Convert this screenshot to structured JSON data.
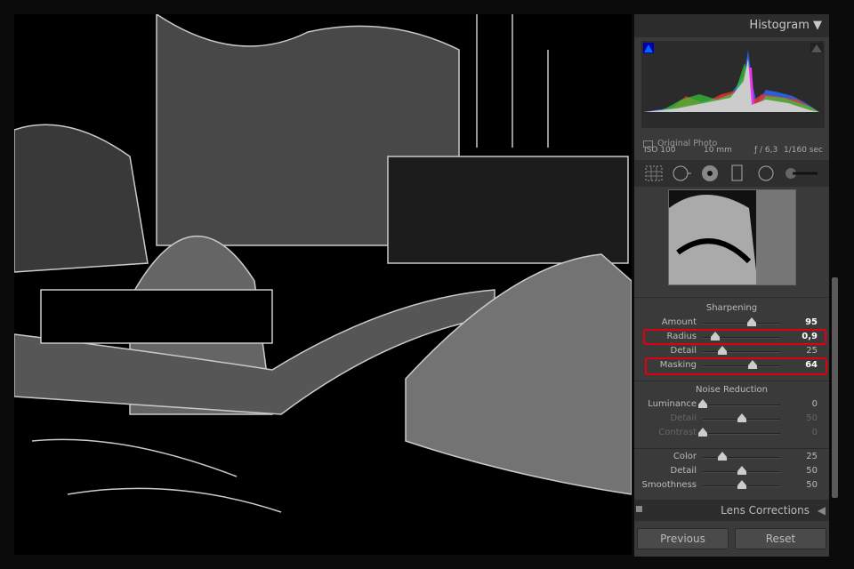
{
  "histogram": {
    "title": "Histogram",
    "collapse_icon": "triangle-down-icon",
    "iso": "ISO 100",
    "focal": "10 mm",
    "aperture": "ƒ / 6,3",
    "shutter": "1/160 sec",
    "original_photo": "Original Photo"
  },
  "tools": [
    "grid-overlay-icon",
    "spot-removal-icon",
    "red-eye-icon",
    "graduated-filter-icon",
    "radial-filter-icon",
    "adjustment-brush-icon"
  ],
  "sharpening": {
    "title": "Sharpening",
    "sliders": [
      {
        "label": "Amount",
        "value": "95",
        "fraction": 0.63
      },
      {
        "label": "Radius",
        "value": "0,9",
        "fraction": 0.16
      },
      {
        "label": "Detail",
        "value": "25",
        "fraction": 0.25
      },
      {
        "label": "Masking",
        "value": "64",
        "fraction": 0.64
      }
    ]
  },
  "noise": {
    "title": "Noise Reduction",
    "sliders": [
      {
        "label": "Luminance",
        "value": "0",
        "fraction": 0
      },
      {
        "label": "Detail",
        "value": "50",
        "fraction": 0.5
      },
      {
        "label": "Contrast",
        "value": "0",
        "fraction": 0
      },
      {
        "label": "Color",
        "value": "25",
        "fraction": 0.25
      },
      {
        "label": "Detail",
        "value": "50",
        "fraction": 0.5
      },
      {
        "label": "Smoothness",
        "value": "50",
        "fraction": 0.5
      }
    ]
  },
  "lens": {
    "title": "Lens Corrections"
  },
  "buttons": {
    "previous": "Previous",
    "reset": "Reset"
  },
  "colors": {
    "highlight": "#e00010",
    "panel": "#3a3a3a"
  }
}
